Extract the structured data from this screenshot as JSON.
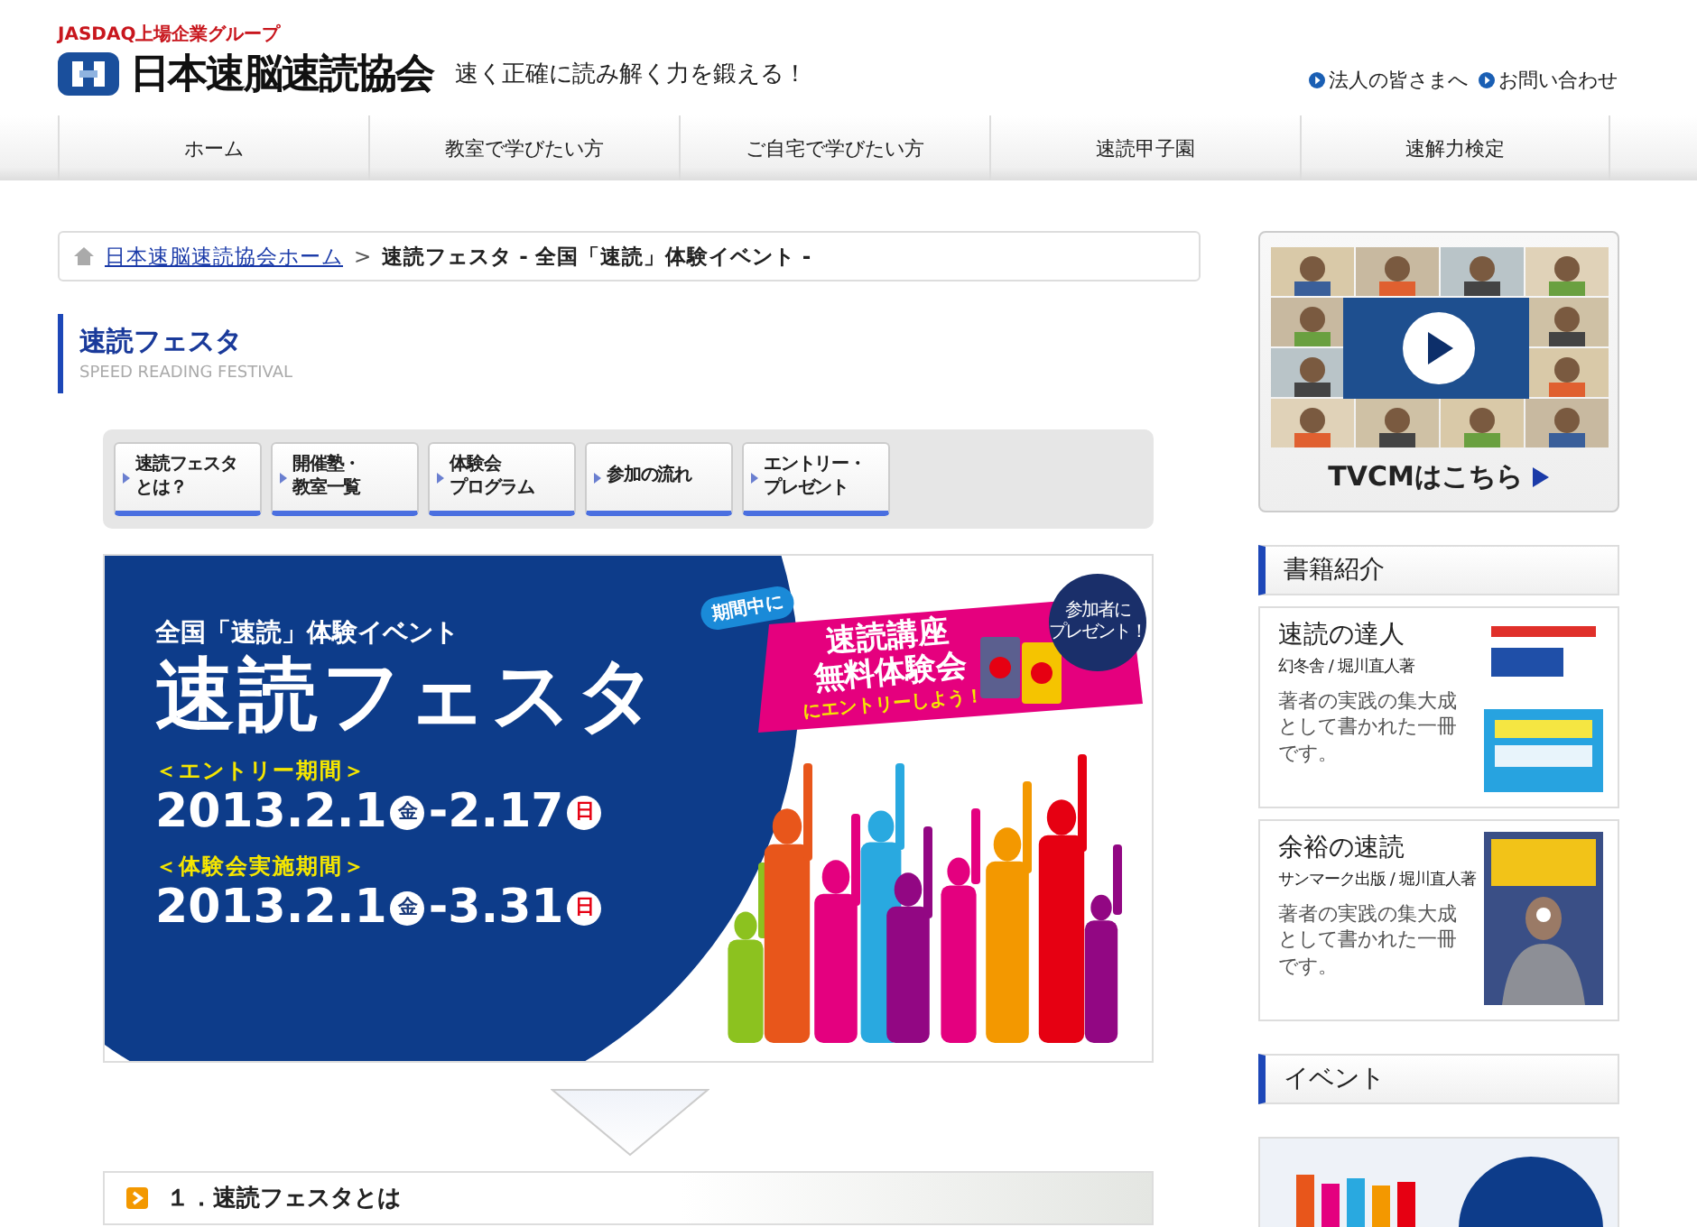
{
  "header": {
    "group_label": "JASDAQ上場企業グループ",
    "logo_text": "日本速脳速読協会",
    "tagline": "速く正確に読み解く力を鍛える！",
    "links": [
      "法人の皆さまへ",
      "お問い合わせ"
    ]
  },
  "nav": [
    {
      "label": "ホーム"
    },
    {
      "label": "教室で学びたい方"
    },
    {
      "label": "ご自宅で学びたい方"
    },
    {
      "label": "速読甲子園"
    },
    {
      "label": "速解力検定"
    }
  ],
  "breadcrumb": {
    "home": "日本速脳速読協会ホーム",
    "separator": ">",
    "current": "速読フェスタ - 全国「速読」体験イベント -"
  },
  "page_title": {
    "title": "速読フェスタ",
    "subtitle": "SPEED READING FESTIVAL"
  },
  "subnav": [
    {
      "lines": [
        "速読フェスタ",
        "とは？"
      ]
    },
    {
      "lines": [
        "開催塾・",
        "教室一覧"
      ]
    },
    {
      "lines": [
        "体験会",
        "プログラム"
      ]
    },
    {
      "lines": [
        "参加の流れ"
      ]
    },
    {
      "lines": [
        "エントリー・",
        "プレゼント"
      ]
    }
  ],
  "banner": {
    "kicker": "全国「速読」体験イベント",
    "title": "速読フェスタ",
    "periods": [
      {
        "label": "＜エントリー期間＞",
        "dates": [
          {
            "text": "2013.2.1",
            "day": "金",
            "sunday": false
          },
          {
            "text": "-2.17",
            "day": "日",
            "sunday": true
          }
        ]
      },
      {
        "label": "＜体験会実施期間＞",
        "dates": [
          {
            "text": "2013.2.1",
            "day": "金",
            "sunday": false
          },
          {
            "text": "-3.31",
            "day": "日",
            "sunday": true
          }
        ]
      }
    ],
    "bubble": "期間中に",
    "promo_lines": [
      "速読講座",
      "無料体験会"
    ],
    "promo_sub": "にエントリーしよう！",
    "gift_lines": [
      "参加者に",
      "プレゼント！"
    ]
  },
  "section": {
    "title": "１．速読フェスタとは"
  },
  "sidebar": {
    "tvcm": {
      "caption": "TVCMはこちら"
    },
    "books_heading": "書籍紹介",
    "books": [
      {
        "title": "速読の達人",
        "publisher": "幻冬舎 / 堀川直人著",
        "description": "著者の実践の集大成として書かれた一冊です。"
      },
      {
        "title": "余裕の速読",
        "publisher": "サンマーク出版 / 堀川直人著",
        "description": "著者の実践の集大成として書かれた一冊です。"
      }
    ],
    "event_heading": "イベント"
  }
}
